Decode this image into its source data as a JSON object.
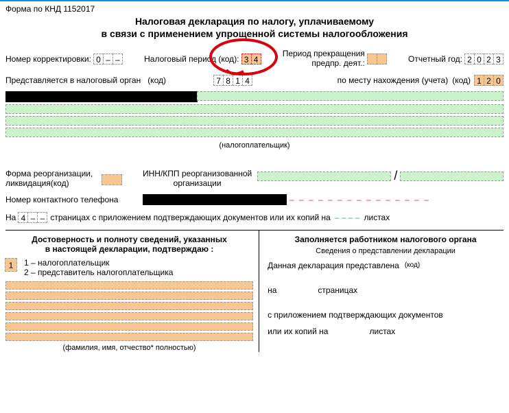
{
  "header": {
    "form_code": "Форма по КНД 1152017",
    "title_line1": "Налоговая декларация по налогу, уплачиваемому",
    "title_line2": "в связи с применением упрощенной системы налогообложения"
  },
  "line1": {
    "corr_label": "Номер корректировки:",
    "corr_cells": [
      "0",
      "–",
      "–"
    ],
    "tax_period_label": "Налоговый период (код):",
    "tax_period_cells": [
      "3",
      "4"
    ],
    "termination_label1": "Период прекращения",
    "termination_label2": "предпр. деят.:",
    "termination_cells": [
      "",
      ""
    ],
    "year_label": "Отчетный год:",
    "year_cells": [
      "2",
      "0",
      "2",
      "3"
    ]
  },
  "line2": {
    "submit_label": "Представляется в налоговый орган",
    "code_label": "(код)",
    "submit_cells": [
      "7",
      "8",
      "1",
      "4"
    ],
    "place_label": "по месту нахождения (учета)",
    "place_cells": [
      "1",
      "2",
      "0"
    ]
  },
  "taxpayer_caption": "(налогоплательщик)",
  "reorg": {
    "label1": "Форма реорганизации,",
    "label2": "ликвидация(код)",
    "inn_label1": "ИНН/КПП реорганизованной",
    "inn_label2": "организации",
    "slash": "/"
  },
  "phone": {
    "label": "Номер контактного телефона",
    "dashfill": "– – – – – – – – – – – – – – –"
  },
  "pages": {
    "pre": "На",
    "pages_cells": [
      "4",
      "–",
      "–"
    ],
    "mid": "страницах с приложением подтверждающих документов или их копий на",
    "dashes": "– – – –",
    "sheets": "листах"
  },
  "left": {
    "heading1": "Достоверность и полноту сведений, указанных",
    "heading2": "в настоящей декларации, подтверждаю :",
    "opt_val": "1",
    "opt1": "1 – налогоплательщик",
    "opt2": "2 – представитель налогоплательщика",
    "fio_note": "(фамилия, имя, отчество* полностью)"
  },
  "right": {
    "heading": "Заполняется работником налогового органа",
    "sub": "Сведения о представлении декларации",
    "line_presented": "Данная декларация представлена",
    "code": "(код)",
    "on": "на",
    "pages_word": "страницах",
    "attach": "с приложением подтверждающих документов",
    "copies": "или их копий на",
    "sheets_word": "листах"
  }
}
